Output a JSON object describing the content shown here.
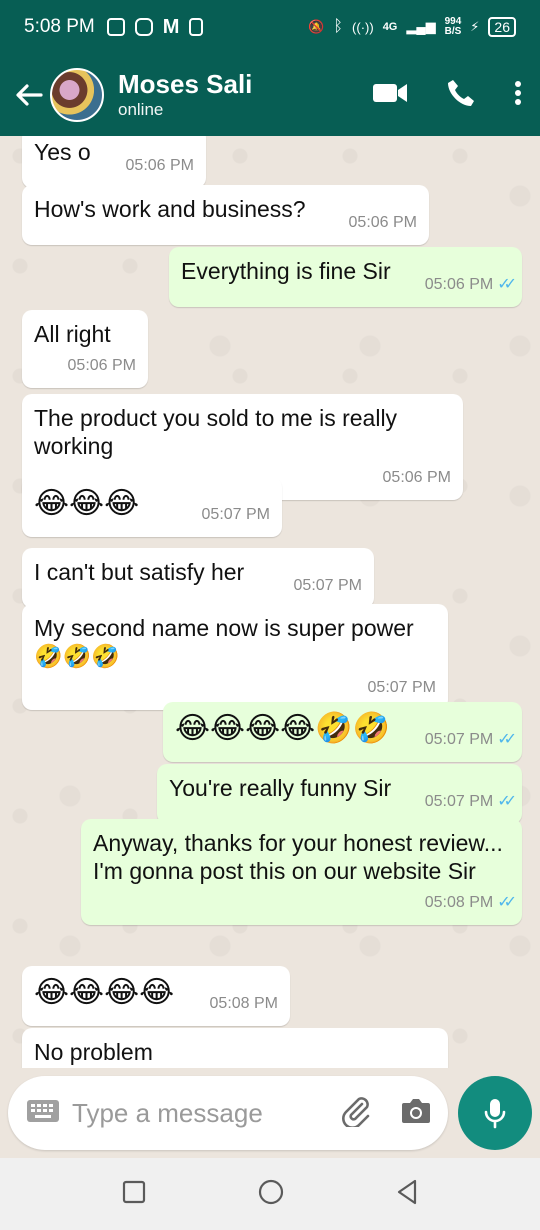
{
  "status_bar": {
    "time": "5:08 PM",
    "network": "4G",
    "speed_value": "994",
    "speed_unit": "B/S",
    "battery": "26"
  },
  "header": {
    "contact_name": "Moses Sali",
    "contact_status": "online"
  },
  "messages": [
    {
      "direction": "in",
      "text": "Yes o",
      "time": "05:06 PM"
    },
    {
      "direction": "in",
      "text": "How's work and business?",
      "time": "05:06 PM"
    },
    {
      "direction": "out",
      "text": "Everything is fine Sir",
      "time": "05:06 PM",
      "read": true
    },
    {
      "direction": "in",
      "text": "All right",
      "time": "05:06 PM"
    },
    {
      "direction": "in",
      "text": "The product you sold to me is really working",
      "time": "05:06 PM"
    },
    {
      "direction": "in",
      "text": "😂😂😂",
      "time": "05:07 PM"
    },
    {
      "direction": "in",
      "text": "I can't but satisfy her",
      "time": "05:07 PM"
    },
    {
      "direction": "in",
      "text": "My second name now is super power 🤣🤣🤣",
      "time": "05:07 PM"
    },
    {
      "direction": "out",
      "text": "😂😂😂😂🤣🤣",
      "time": "05:07 PM",
      "read": true
    },
    {
      "direction": "out",
      "text": "You're really funny Sir",
      "time": "05:07 PM",
      "read": true
    },
    {
      "direction": "out",
      "text": "Anyway, thanks for your honest review...\nI'm gonna post this on our website Sir",
      "time": "05:08 PM",
      "read": true
    },
    {
      "direction": "in",
      "text": "😂😂😂😂",
      "time": "05:08 PM"
    },
    {
      "direction": "in",
      "text": "No problem",
      "time": ""
    }
  ],
  "input": {
    "placeholder": "Type a message"
  },
  "icons": {
    "back": "arrow-left-icon",
    "video": "video-call-icon",
    "call": "phone-icon",
    "menu": "more-vert-icon",
    "keyboard": "keyboard-icon",
    "attach": "paperclip-icon",
    "camera": "camera-icon",
    "mic": "microphone-icon",
    "ticks": "double-check-icon"
  },
  "colors": {
    "header": "#075e54",
    "outgoing_bubble": "#e7ffdb",
    "incoming_bubble": "#ffffff",
    "read_ticks": "#4fb6ec",
    "mic_button": "#128c7e"
  }
}
